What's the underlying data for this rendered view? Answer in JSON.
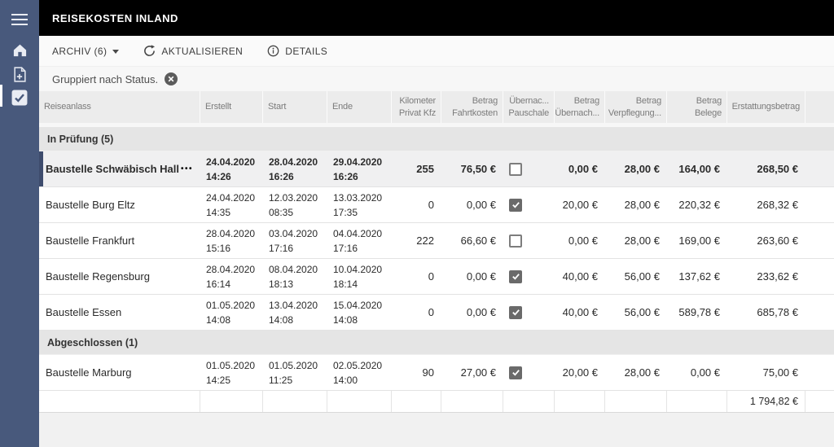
{
  "app": {
    "title": "REISEKOSTEN INLAND"
  },
  "sidebar": {
    "items": [
      {
        "icon": "hamburger-icon",
        "active": false
      },
      {
        "icon": "home-icon",
        "active": false
      },
      {
        "icon": "new-document-icon",
        "active": false
      },
      {
        "icon": "tasks-check-icon",
        "active": true
      }
    ]
  },
  "toolbar": {
    "archive_label": "ARCHIV (6)",
    "refresh_label": "AKTUALISIEREN",
    "details_label": "DETAILS"
  },
  "filter": {
    "text": "Gruppiert nach Status."
  },
  "colors": {
    "sidebar": "#48597c",
    "titlebar": "#000000",
    "selection_accent": "#3e4c6d",
    "checkbox_checked": "#6a6a6a",
    "header_bg": "#ececec",
    "group_bg": "#e5e5e5",
    "selected_row_bg": "#f0f0f1"
  },
  "table": {
    "columns": [
      {
        "key": "reiseanlass",
        "label": "Reiseanlass",
        "align": "left"
      },
      {
        "key": "erstellt",
        "label": "Erstellt",
        "align": "left"
      },
      {
        "key": "start",
        "label": "Start",
        "align": "left"
      },
      {
        "key": "ende",
        "label": "Ende",
        "align": "left"
      },
      {
        "key": "kilometer-privat-kfz",
        "label": "Kilometer Privat Kfz",
        "align": "right"
      },
      {
        "key": "betrag-fahrtkosten",
        "label": "Betrag Fahrtkosten",
        "align": "right"
      },
      {
        "key": "uebernachtungspauschale",
        "label": "Übernac... Pauschale",
        "align": "right"
      },
      {
        "key": "betrag-uebernachtung",
        "label": "Betrag Übernach...",
        "align": "right"
      },
      {
        "key": "betrag-verpflegung",
        "label": "Betrag Verpflegung...",
        "align": "right"
      },
      {
        "key": "betrag-belege",
        "label": "Betrag Belege",
        "align": "right"
      },
      {
        "key": "erstattungsbetrag",
        "label": "Erstattungsbetrag",
        "align": "right"
      },
      {
        "key": "spacer",
        "label": "",
        "align": "left"
      }
    ],
    "groups": [
      {
        "label": "In Prüfung (5)",
        "rows": [
          {
            "name": "Baustelle Schwäbisch Hall",
            "menu": "•••",
            "selected": true,
            "created": [
              "24.04.2020",
              "14:26"
            ],
            "start": [
              "28.04.2020",
              "16:26"
            ],
            "end": [
              "29.04.2020",
              "16:26"
            ],
            "km": "255",
            "fahrtkosten": "76,50 €",
            "pauschale": false,
            "uebernachtung": "0,00 €",
            "verpflegung": "28,00 €",
            "belege": "164,00 €",
            "erstattung": "268,50 €"
          },
          {
            "name": "Baustelle Burg Eltz",
            "selected": false,
            "created": [
              "24.04.2020",
              "14:35"
            ],
            "start": [
              "12.03.2020",
              "08:35"
            ],
            "end": [
              "13.03.2020",
              "17:35"
            ],
            "km": "0",
            "fahrtkosten": "0,00 €",
            "pauschale": true,
            "uebernachtung": "20,00 €",
            "verpflegung": "28,00 €",
            "belege": "220,32 €",
            "erstattung": "268,32 €"
          },
          {
            "name": "Baustelle Frankfurt",
            "selected": false,
            "created": [
              "28.04.2020",
              "15:16"
            ],
            "start": [
              "03.04.2020",
              "17:16"
            ],
            "end": [
              "04.04.2020",
              "17:16"
            ],
            "km": "222",
            "fahrtkosten": "66,60 €",
            "pauschale": false,
            "uebernachtung": "0,00 €",
            "verpflegung": "28,00 €",
            "belege": "169,00 €",
            "erstattung": "263,60 €"
          },
          {
            "name": "Baustelle Regensburg",
            "selected": false,
            "created": [
              "28.04.2020",
              "16:14"
            ],
            "start": [
              "08.04.2020",
              "18:13"
            ],
            "end": [
              "10.04.2020",
              "18:14"
            ],
            "km": "0",
            "fahrtkosten": "0,00 €",
            "pauschale": true,
            "uebernachtung": "40,00 €",
            "verpflegung": "56,00 €",
            "belege": "137,62 €",
            "erstattung": "233,62 €"
          },
          {
            "name": "Baustelle Essen",
            "selected": false,
            "created": [
              "01.05.2020",
              "14:08"
            ],
            "start": [
              "13.04.2020",
              "14:08"
            ],
            "end": [
              "15.04.2020",
              "14:08"
            ],
            "km": "0",
            "fahrtkosten": "0,00 €",
            "pauschale": true,
            "uebernachtung": "40,00 €",
            "verpflegung": "56,00 €",
            "belege": "589,78 €",
            "erstattung": "685,78 €"
          }
        ]
      },
      {
        "label": "Abgeschlossen (1)",
        "rows": [
          {
            "name": "Baustelle Marburg",
            "selected": false,
            "created": [
              "01.05.2020",
              "14:25"
            ],
            "start": [
              "01.05.2020",
              "11:25"
            ],
            "end": [
              "02.05.2020",
              "14:00"
            ],
            "km": "90",
            "fahrtkosten": "27,00 €",
            "pauschale": true,
            "uebernachtung": "20,00 €",
            "verpflegung": "28,00 €",
            "belege": "0,00 €",
            "erstattung": "75,00 €"
          }
        ]
      }
    ],
    "total": "1 794,82 €"
  }
}
